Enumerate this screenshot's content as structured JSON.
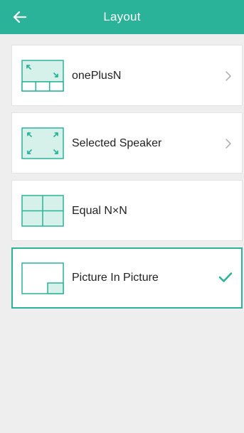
{
  "header": {
    "title": "Layout",
    "back_icon": "arrow-left-icon"
  },
  "colors": {
    "accent": "#2bb39a",
    "thumb_fill": "#d6f0ea",
    "background": "#eeeeee"
  },
  "layouts": [
    {
      "label": "onePlusN",
      "icon": "one-plus-n-layout-icon",
      "trailing": "chevron-right-icon",
      "selected": false
    },
    {
      "label": "Selected Speaker",
      "icon": "selected-speaker-layout-icon",
      "trailing": "chevron-right-icon",
      "selected": false
    },
    {
      "label": "Equal N×N",
      "icon": "equal-n-by-n-layout-icon",
      "trailing": null,
      "selected": false
    },
    {
      "label": "Picture In Picture",
      "icon": "picture-in-picture-layout-icon",
      "trailing": "checkmark-icon",
      "selected": true
    }
  ]
}
